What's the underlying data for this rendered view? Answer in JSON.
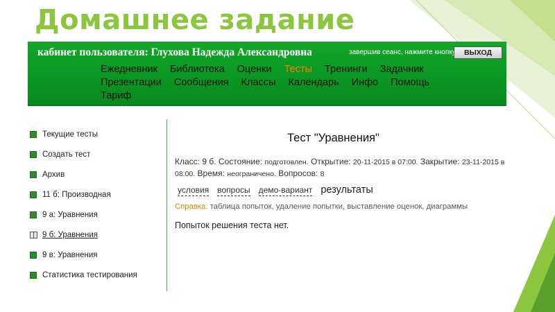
{
  "slide": {
    "title": "Домашнее задание"
  },
  "header": {
    "user_label": "кабинет пользователя: Глухова Надежда Александровна",
    "logout_hint": "завершив сеанс, нажмите кнопку",
    "logout_button": "ВЫХОД"
  },
  "menu": {
    "rows": [
      [
        "Ежедневник",
        "Библиотека",
        "Оценки",
        "Тесты",
        "Тренинги",
        "Задачник"
      ],
      [
        "Презентации",
        "Сообщения",
        "Классы",
        "Календарь",
        "Инфо",
        "Помощь"
      ],
      [
        "Тариф"
      ]
    ],
    "active": "Тесты"
  },
  "sidebar": {
    "items": [
      {
        "label": "Текущие тесты",
        "icon": "square-bullet-icon"
      },
      {
        "label": "Создать тест",
        "icon": "square-bullet-icon"
      },
      {
        "label": "Архив",
        "icon": "square-bullet-icon"
      },
      {
        "label": "11 б: Производная",
        "icon": "square-bullet-icon"
      },
      {
        "label": "9 а: Уравнения",
        "icon": "square-bullet-icon"
      },
      {
        "label": "9 б: Уравнения",
        "icon": "open-book-icon",
        "current": true
      },
      {
        "label": "9 в: Уравнения",
        "icon": "square-bullet-icon"
      },
      {
        "label": "Статистика тестирования",
        "icon": "square-bullet-icon"
      }
    ]
  },
  "test": {
    "title": "Тест \"Уравнения\"",
    "class_label": "Класс:",
    "class_value": "9 б.",
    "state_label": "Состояние:",
    "state_value": "подготовлен.",
    "open_label": "Открытие:",
    "open_value": "20-11-2015 в 07:00.",
    "close_label": "Закрытие:",
    "close_value": "23-11-2015 в 08:00.",
    "time_label": "Время:",
    "time_value": "неограничено.",
    "questions_label": "Вопросов:",
    "questions_value": "8",
    "tabs": [
      "условия",
      "вопросы",
      "демо-вариант",
      "результаты"
    ],
    "active_tab": "результаты",
    "help_label": "Справка:",
    "help_links": [
      "таблица попыток",
      "удаление попытки",
      "выставление оценок",
      "диаграммы"
    ],
    "no_attempts": "Попыток решения теста нет."
  },
  "colors": {
    "slide_title": "#8cc63f",
    "topbar": "#0b9a23",
    "active_menu": "#ff7a00",
    "bullet": "#2f8a2f",
    "help_label": "#cc8a00"
  }
}
